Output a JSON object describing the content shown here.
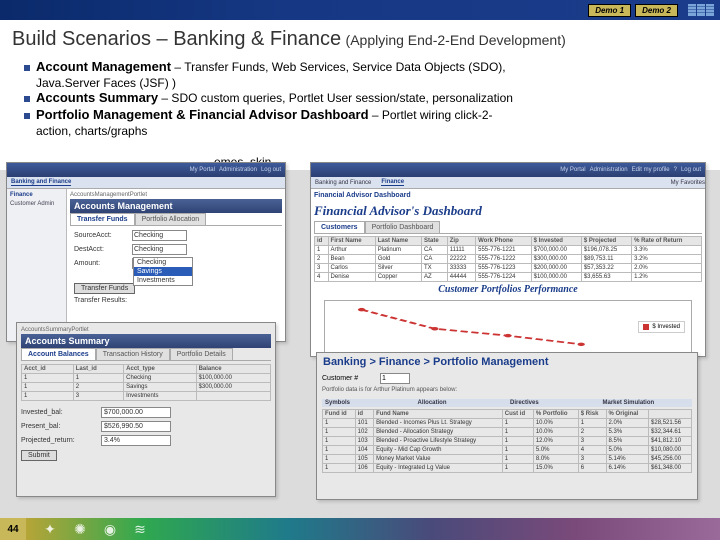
{
  "topbar": {
    "demo1": "Demo 1",
    "demo2": "Demo 2"
  },
  "title": {
    "main": "Build Scenarios – Banking & Finance",
    "sub": "(Applying End-2-End Development)"
  },
  "bullets": {
    "b1_strong": "Account Management",
    "b1_rest": " – Transfer Funds, Web Services, Service Data Objects (SDO),",
    "b1_cont": "Java.Server Faces (JSF) )",
    "b2_strong": "Accounts Summary",
    "b2_rest": " – SDO custom queries, Portlet User session/state, personalization",
    "b3_strong": "Portfolio Management & Financial Advisor Dashboard",
    "b3_rest": " – Portlet wiring click-2-",
    "b3_cont": "action, charts/graphs",
    "themes_frag": "emes, skin"
  },
  "portal_links": {
    "l1": "My Portal",
    "l2": "Administration",
    "l3": "Edit my profile",
    "l4": "?",
    "l5": "Log out",
    "my_fav": "My Favorites"
  },
  "nav": {
    "t1": "Banking and Finance",
    "t2": "Finance",
    "right": "My Favorites"
  },
  "am": {
    "side_head": "Finance",
    "side_item": "Customer Admin",
    "portlet_t": "AccountsManagementPortlet",
    "heading": "Accounts Management",
    "tab_active": "Transfer Funds",
    "tab_other": "Portfolio Allocation",
    "f_source": "SourceAcct:",
    "f_source_v": "Checking",
    "f_dest": "DestAcct:",
    "f_dest_v": "Checking",
    "f_amount": "Amount:",
    "dd_o1": "Checking",
    "dd_o2": "Savings",
    "dd_o3": "Investments",
    "btn": "Transfer Funds",
    "result": "Transfer Results:"
  },
  "as": {
    "portlet_t": "AccountsSummaryPortlet",
    "heading": "Accounts Summary",
    "tab_active": "Account Balances",
    "tab2": "Transaction History",
    "tab3": "Portfolio Details",
    "th1": "Acct_id",
    "th2": "Last_id",
    "th3": "Acct_type",
    "th4": "Balance",
    "r1c1": "1",
    "r1c2": "1",
    "r1c3": "Checking",
    "r1c4": "$100,000.00",
    "r2c1": "1",
    "r2c2": "2",
    "r2c3": "Savings",
    "r2c4": "$300,000.00",
    "r3c1": "1",
    "r3c2": "3",
    "r3c3": "Investments",
    "r3c4": "",
    "empty": "",
    "l_invested": "Invested_bal:",
    "v_invested": "$700,000.00",
    "l_present": "Present_bal:",
    "v_present": "$526,990.50",
    "l_proj": "Projected_return:",
    "v_proj": "3.4%",
    "btn": "Submit"
  },
  "dash": {
    "side_head": "Financial Advisor Dashboard",
    "side_item": "Finance",
    "title": "Financial Advisor's Dashboard",
    "tab1": "Customers",
    "tab2": "Portfolio Dashboard",
    "cth0": "id",
    "cth1": "First Name",
    "cth2": "Last Name",
    "cth3": "State",
    "cth4": "Zip",
    "cth5": "Work Phone",
    "cth6": "$ Invested",
    "cth7": "$ Projected",
    "cth8": "% Rate of Return",
    "cr": [
      [
        "1",
        "Arthur",
        "Platinum",
        "CA",
        "11111",
        "555-776-1221",
        "$700,000.00",
        "$196,078.25",
        "3.3%"
      ],
      [
        "2",
        "Bean",
        "Gold",
        "CA",
        "22222",
        "555-776-1222",
        "$300,000.00",
        "$89,753.11",
        "3.2%"
      ],
      [
        "3",
        "Carlos",
        "Silver",
        "TX",
        "33333",
        "555-776-1223",
        "$200,000.00",
        "$57,353.22",
        "2.0%"
      ],
      [
        "4",
        "Denise",
        "Copper",
        "AZ",
        "44444",
        "555-776-1224",
        "$100,000.00",
        "$3,655.63",
        "1.2%"
      ]
    ],
    "chart_title": "Customer Portfolios Performance",
    "legend": "$ Invested"
  },
  "chart_data": {
    "type": "line",
    "categories": [
      "1",
      "2",
      "3",
      "4"
    ],
    "series": [
      {
        "name": "$ Invested",
        "values": [
          700000,
          300000,
          200000,
          100000
        ]
      }
    ],
    "title": "Customer Portfolios Performance",
    "xlabel": "",
    "ylabel": "",
    "ylim": [
      0,
      800000
    ]
  },
  "port": {
    "bc": "Banking > Finance > Portfolio Management",
    "cust_l": "Customer #",
    "cust_v": "1",
    "note": "Portfolio data is for Arthur Platinum appears below:",
    "sub1": "Symbols",
    "sub2": "Allocation",
    "sub3": "Directives",
    "sub4": "Market Simulation",
    "th1": "Fund id",
    "th2": "id",
    "th3": "Fund Name",
    "th4": "Cust id",
    "th5": "% Portfolio",
    "th6": "$ Risk",
    "th7": "% Original",
    "rows": [
      [
        "1",
        "101",
        "Blended - Incomes Plus Lt. Strategy",
        "1",
        "10.0%",
        "1",
        "2.0%",
        "$28,521.56"
      ],
      [
        "1",
        "102",
        "Blended - Allocation Strategy",
        "1",
        "10.0%",
        "2",
        "5.3%",
        "$32,344.61"
      ],
      [
        "1",
        "103",
        "Blended - Proactive Lifestyle Strategy",
        "1",
        "12.0%",
        "3",
        "8.5%",
        "$41,812.10"
      ],
      [
        "1",
        "104",
        "Equity - Mid Cap Growth",
        "1",
        "5.0%",
        "4",
        "5.0%",
        "$10,080.00"
      ],
      [
        "1",
        "105",
        "Money Market Value",
        "1",
        "8.0%",
        "3",
        "5.14%",
        "$45,256.00"
      ],
      [
        "1",
        "106",
        "Equity - Integrated Lg Value",
        "1",
        "15.0%",
        "6",
        "6.14%",
        "$61,348.00"
      ]
    ]
  },
  "footer": {
    "page": "44"
  }
}
